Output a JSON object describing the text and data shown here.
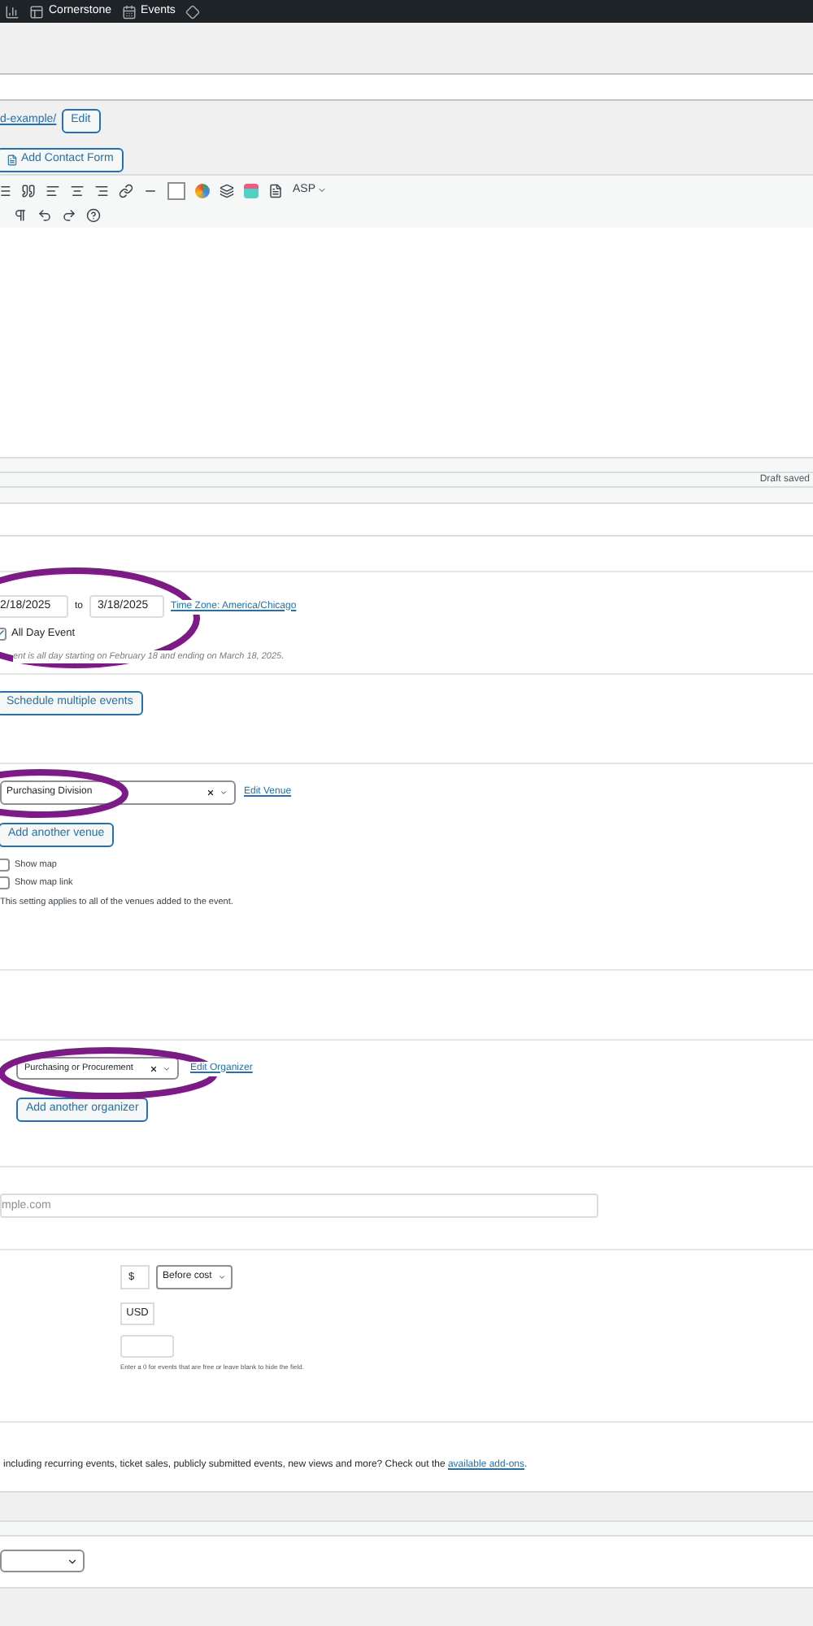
{
  "admin_bar": {
    "items": [
      "Cornerstone",
      "Events"
    ]
  },
  "permalink": {
    "slug": "d-example/",
    "edit_button": "Edit"
  },
  "add_contact_form": "Add Contact Form",
  "toolbar": {
    "dropdown": "ASP"
  },
  "status_bar": {
    "text": "Draft saved"
  },
  "date_time": {
    "start_date": "2/18/2025",
    "separator": "to",
    "end_date": "3/18/2025",
    "timezone_link": "Time Zone: America/Chicago",
    "all_day": {
      "label": "All Day Event",
      "checked": true
    },
    "summary": "ent is all day starting on February 18 and ending on March 18, 2025.",
    "schedule_button": "Schedule multiple events"
  },
  "venue": {
    "selected": "Purchasing Division",
    "edit_link": "Edit Venue",
    "add_button": "Add another venue",
    "options": [
      {
        "label": "Show map",
        "checked": false
      },
      {
        "label": "Show map link",
        "checked": false
      }
    ],
    "note": "This setting applies to all of the venues added to the event."
  },
  "organizer": {
    "selected": "Purchasing or Procurement",
    "edit_link": "Edit Organizer",
    "add_button": "Add another organizer"
  },
  "website": {
    "placeholder": "mple.com"
  },
  "cost": {
    "symbol": "$",
    "position": "Before cost",
    "currency": "USD",
    "hint": "Enter a 0 for events that are free or leave blank to hide the field."
  },
  "addons": {
    "text": "including recurring events, ticket sales, publicly submitted events, new views and more? Check out the ",
    "link": "available add-ons",
    "end": "."
  }
}
